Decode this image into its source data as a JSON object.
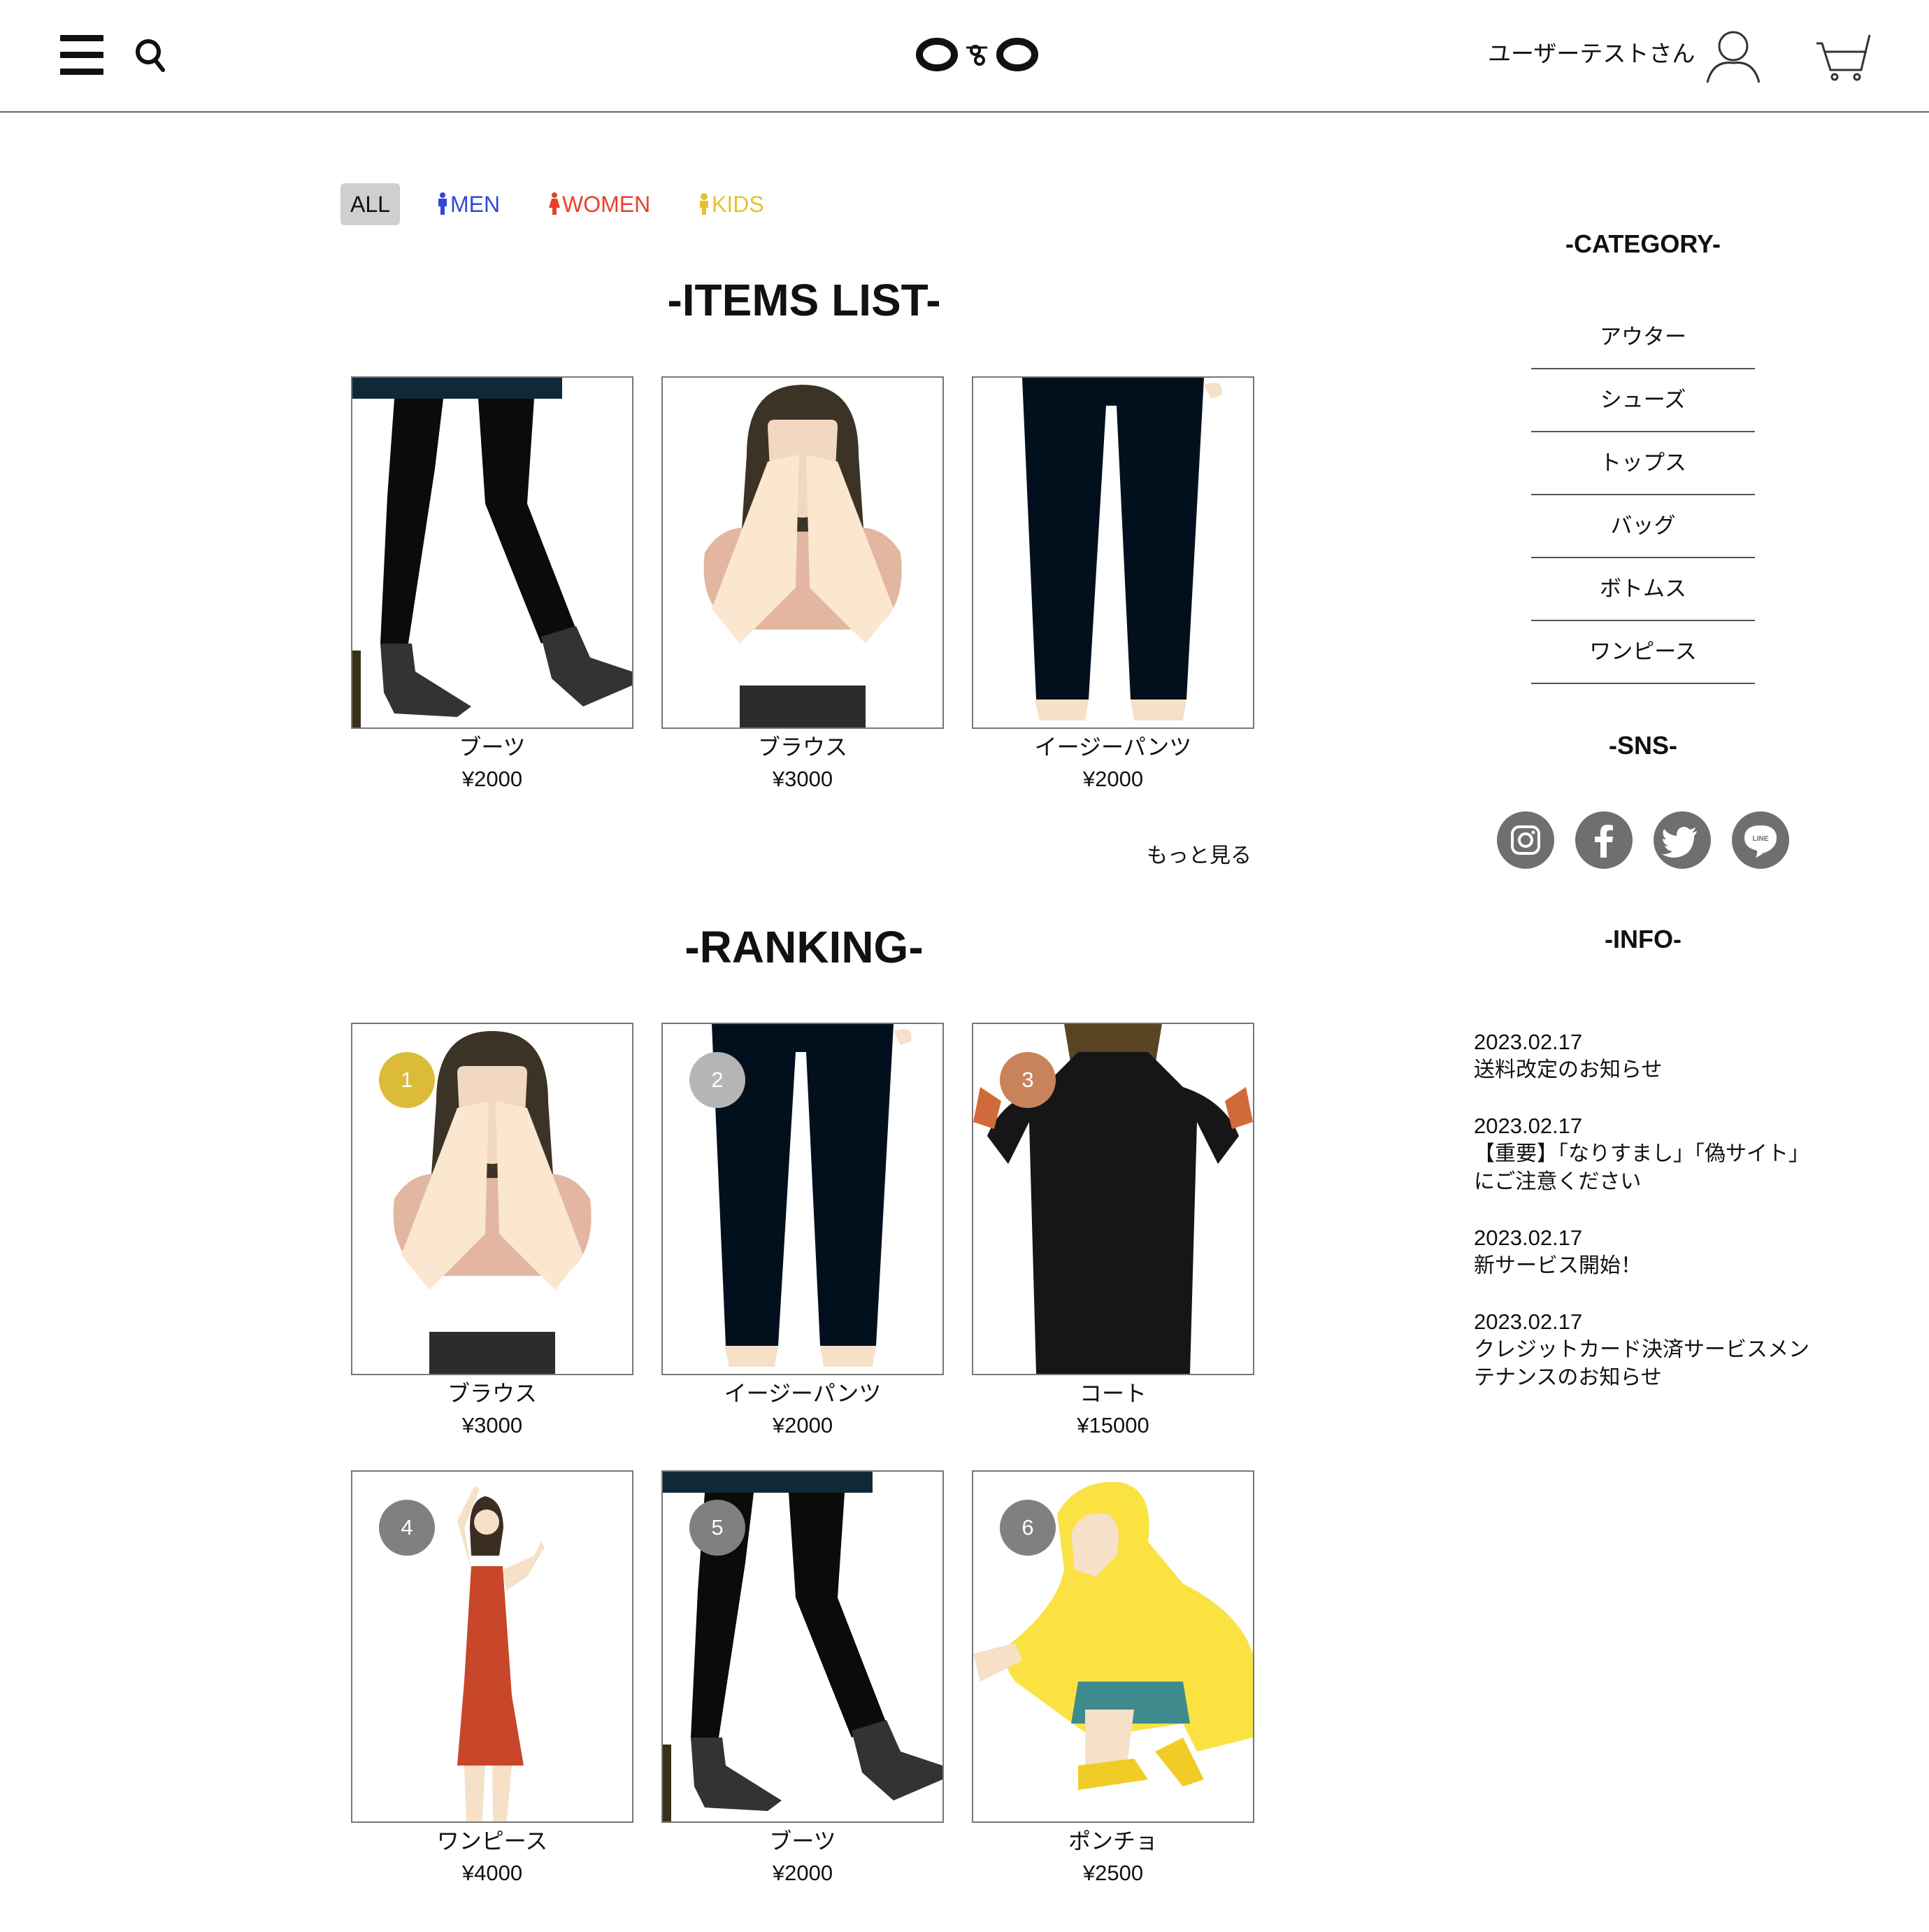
{
  "header": {
    "user_name": "ユーザーテストさん"
  },
  "filters": [
    {
      "label": "ALL",
      "color": "#111111"
    },
    {
      "label": "MEN",
      "color": "#3348d4"
    },
    {
      "label": "WOMEN",
      "color": "#e8412b"
    },
    {
      "label": "KIDS",
      "color": "#e6c12f"
    }
  ],
  "items_list": {
    "title": "-ITEMS LIST-",
    "more_label": "もっと見る",
    "items": [
      {
        "name": "ブーツ",
        "price": "¥2000",
        "image": "boots-illustration"
      },
      {
        "name": "ブラウス",
        "price": "¥3000",
        "image": "blouse-illustration"
      },
      {
        "name": "イージーパンツ",
        "price": "¥2000",
        "image": "easy-pants-illustration"
      }
    ]
  },
  "ranking": {
    "title": "-RANKING-",
    "items": [
      {
        "rank": "1",
        "name": "ブラウス",
        "price": "¥3000",
        "badge_color": "#dcbb3a",
        "image": "blouse-illustration"
      },
      {
        "rank": "2",
        "name": "イージーパンツ",
        "price": "¥2000",
        "badge_color": "#b5b5b5",
        "image": "easy-pants-illustration"
      },
      {
        "rank": "3",
        "name": "コート",
        "price": "¥15000",
        "badge_color": "#c9835a",
        "image": "coat-illustration"
      },
      {
        "rank": "4",
        "name": "ワンピース",
        "price": "¥4000",
        "badge_color": "#808080",
        "image": "dress-illustration"
      },
      {
        "rank": "5",
        "name": "ブーツ",
        "price": "¥2000",
        "badge_color": "#808080",
        "image": "boots-illustration"
      },
      {
        "rank": "6",
        "name": "ポンチョ",
        "price": "¥2500",
        "badge_color": "#808080",
        "image": "poncho-illustration"
      }
    ]
  },
  "sidebar": {
    "category_title": "-CATEGORY-",
    "categories": [
      "アウター",
      "シューズ",
      "トップス",
      "バッグ",
      "ボトムス",
      "ワンピース"
    ],
    "sns_title": "-SNS-",
    "sns": [
      "instagram-icon",
      "facebook-icon",
      "twitter-icon",
      "line-icon"
    ],
    "info_title": "-INFO-",
    "news": [
      {
        "date": "2023.02.17",
        "text": "送料改定のお知らせ"
      },
      {
        "date": "2023.02.17",
        "text": "【重要】「なりすまし」「偽サイト」にご注意ください"
      },
      {
        "date": "2023.02.17",
        "text": "新サービス開始！"
      },
      {
        "date": "2023.02.17",
        "text": "クレジットカード決済サービスメンテナンスのお知らせ"
      }
    ]
  }
}
